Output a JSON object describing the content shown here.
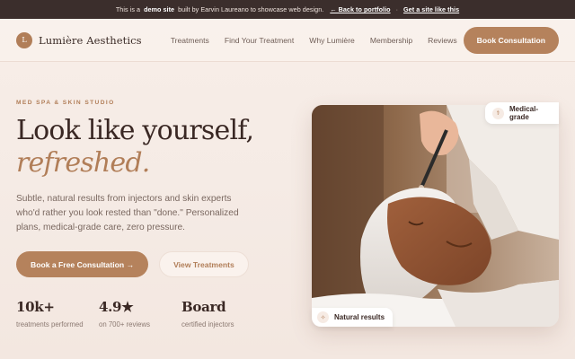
{
  "banner": {
    "prefix": "This is a",
    "demo": "demo site",
    "middle": "built by Earvin Laureano to showcase web design.",
    "back_link": "← Back to portfolio",
    "get_link": "Get a site like this"
  },
  "header": {
    "brand_initial": "L",
    "brand_name": "Lumière Aesthetics",
    "nav": [
      "Treatments",
      "Find Your Treatment",
      "Why Lumière",
      "Membership",
      "Reviews"
    ],
    "cta": "Book Consultation"
  },
  "hero": {
    "eyebrow": "MED SPA & SKIN STUDIO",
    "title_line1": "Look like yourself,",
    "title_line2": "refreshed.",
    "subtitle": "Subtle, natural results from injectors and skin experts who'd rather you look rested than \"done.\" Personalized plans, medical-grade care, zero pressure.",
    "primary_button": "Book a Free Consultation →",
    "secondary_button": "View Treatments",
    "stats": [
      {
        "value": "10k+",
        "label": "treatments performed"
      },
      {
        "value": "4.9★",
        "label": "on 700+ reviews"
      },
      {
        "value": "Board",
        "label": "certified injectors"
      }
    ]
  },
  "photo": {
    "badge_top": "Medical-grade",
    "badge_top_icon": "stethoscope-icon",
    "badge_bottom": "Natural results",
    "badge_bottom_icon": "sparkle-icon"
  },
  "colors": {
    "accent": "#b5825c",
    "banner_bg": "#3b2e2c",
    "heading": "#3a2824",
    "page_bg": "#f7ede7"
  }
}
